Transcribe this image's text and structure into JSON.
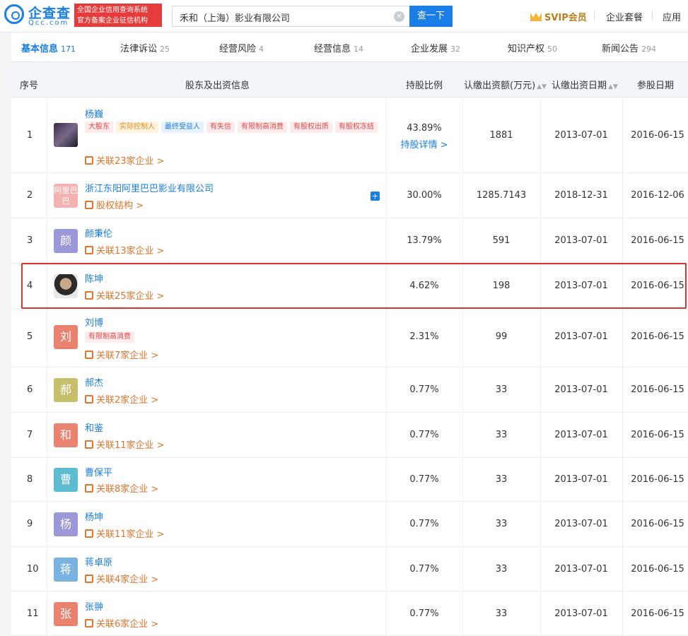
{
  "header": {
    "logo_cn": "企查查",
    "logo_en": "Qcc.com",
    "badge_line1": "全国企业信用查询系统",
    "badge_line2": "官方备案企业征信机构",
    "search_value": "禾和（上海）影业有限公司",
    "search_button": "查一下",
    "svip": "SVIP会员",
    "nav_package": "企业套餐",
    "nav_apps": "应用"
  },
  "tabs": [
    {
      "label": "基本信息",
      "count": "171"
    },
    {
      "label": "法律诉讼",
      "count": "25"
    },
    {
      "label": "经营风险",
      "count": "4"
    },
    {
      "label": "经营信息",
      "count": "14"
    },
    {
      "label": "企业发展",
      "count": "32"
    },
    {
      "label": "知识产权",
      "count": "50"
    },
    {
      "label": "新闻公告",
      "count": "294"
    }
  ],
  "table": {
    "headers": {
      "idx": "序号",
      "holder": "股东及出资信息",
      "pct": "持股比例",
      "amount": "认缴出资额(万元)",
      "date": "认缴出资日期",
      "join": "参股日期"
    },
    "rows": [
      {
        "idx": "1",
        "name": "杨巍",
        "avatar": "",
        "tags": [
          "大股东",
          "实际控制人",
          "最终受益人",
          "有失信",
          "有限制高消费",
          "有股权出质",
          "有股权冻结"
        ],
        "rel": "关联23家企业 >",
        "pct": "43.89%",
        "detail": "持股详情 >",
        "amount": "1881",
        "date": "2013-07-01",
        "join": "2016-06-15"
      },
      {
        "idx": "2",
        "name": "浙江东阳阿里巴巴影业有限公司",
        "avatar": "阿里巴巴",
        "rel": "股权结构 >",
        "pct": "30.00%",
        "amount": "1285.7143",
        "date": "2018-12-31",
        "join": "2016-12-06"
      },
      {
        "idx": "3",
        "name": "颜秉伦",
        "avatar": "颜",
        "rel": "关联13家企业 >",
        "pct": "13.79%",
        "amount": "591",
        "date": "2013-07-01",
        "join": "2016-06-15"
      },
      {
        "idx": "4",
        "name": "陈坤",
        "avatar": "",
        "rel": "关联25家企业 >",
        "pct": "4.62%",
        "amount": "198",
        "date": "2013-07-01",
        "join": "2016-06-15"
      },
      {
        "idx": "5",
        "name": "刘博",
        "avatar": "刘",
        "tags": [
          "有限制高消费"
        ],
        "rel": "关联7家企业 >",
        "pct": "2.31%",
        "amount": "99",
        "date": "2013-07-01",
        "join": "2016-06-15"
      },
      {
        "idx": "6",
        "name": "郝杰",
        "avatar": "郝",
        "rel": "关联2家企业 >",
        "pct": "0.77%",
        "amount": "33",
        "date": "2013-07-01",
        "join": "2016-06-15"
      },
      {
        "idx": "7",
        "name": "和鉴",
        "avatar": "和",
        "rel": "关联11家企业 >",
        "pct": "0.77%",
        "amount": "33",
        "date": "2013-07-01",
        "join": "2016-06-15"
      },
      {
        "idx": "8",
        "name": "曹保平",
        "avatar": "曹",
        "rel": "关联8家企业 >",
        "pct": "0.77%",
        "amount": "33",
        "date": "2013-07-01",
        "join": "2016-06-15"
      },
      {
        "idx": "9",
        "name": "杨坤",
        "avatar": "杨",
        "rel": "关联11家企业 >",
        "pct": "0.77%",
        "amount": "33",
        "date": "2013-07-01",
        "join": "2016-06-15"
      },
      {
        "idx": "10",
        "name": "蒋卓原",
        "avatar": "蒋",
        "rel": "关联4家企业 >",
        "pct": "0.77%",
        "amount": "33",
        "date": "2013-07-01",
        "join": "2016-06-15"
      },
      {
        "idx": "11",
        "name": "张翀",
        "avatar": "张",
        "rel": "关联6家企业 >",
        "pct": "0.77%",
        "amount": "33",
        "date": "2013-07-01",
        "join": "2016-06-15"
      }
    ]
  },
  "colors": {
    "accent": "#1a7ee6",
    "highlight_border": "#d6342c",
    "relation": "#e0752d"
  }
}
